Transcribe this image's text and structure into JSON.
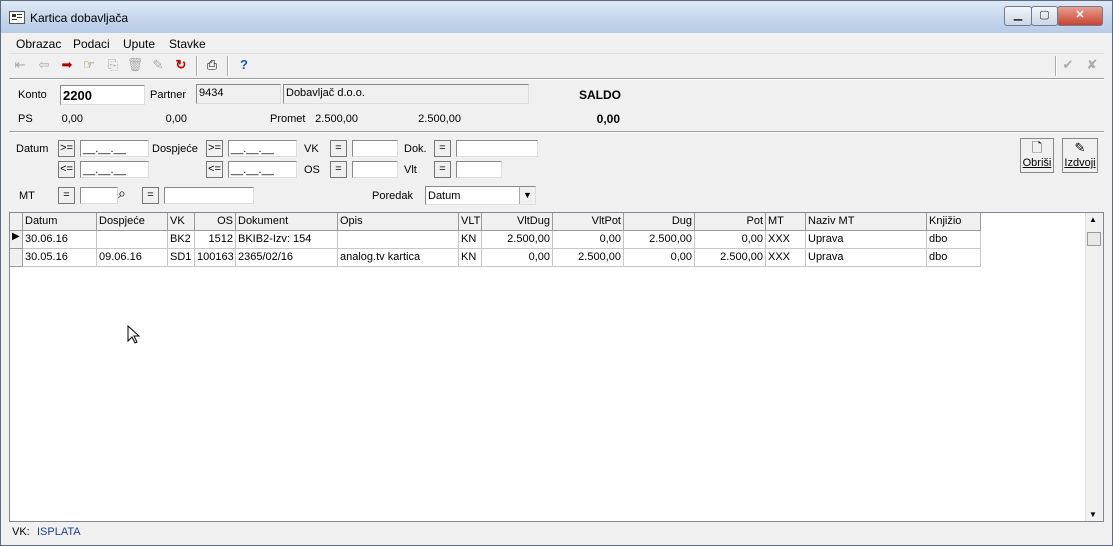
{
  "window": {
    "title": "Kartica dobavljača"
  },
  "window_controls": {
    "minimize": "▁",
    "maximize": "▢",
    "close": "✕"
  },
  "menu": [
    "Obrazac",
    "Podaci",
    "Upute",
    "Stavke"
  ],
  "header": {
    "konto_label": "Konto",
    "konto_value": "2200",
    "partner_label": "Partner",
    "partner_id": "9434",
    "partner_name": "Dobavljač d.o.o.",
    "saldo_label": "SALDO",
    "ps_label": "PS",
    "ps_dug": "0,00",
    "ps_pot": "0,00",
    "promet_label": "Promet",
    "promet_dug": "2.500,00",
    "promet_pot": "2.500,00",
    "saldo_value": "0,00"
  },
  "filters": {
    "datum_label": "Datum",
    "dospijece_label": "Dospjeće",
    "ge": ">=",
    "le": "<=",
    "eq": "=",
    "date_mask": "__.__.__",
    "vk_label": "VK",
    "os_label": "OS",
    "dok_label": "Dok.",
    "vlt_label": "Vlt",
    "mt_label": "MT",
    "poredak_label": "Poredak",
    "poredak_value": "Datum",
    "obrisi_label": "Obriši",
    "izdvoji_label": "Izdvoji"
  },
  "grid": {
    "columns": [
      "Datum",
      "Dospjeće",
      "VK",
      "OS",
      "Dokument",
      "Opis",
      "VLT",
      "VltDug",
      "VltPot",
      "Dug",
      "Pot",
      "MT",
      "Naziv MT",
      "Knjižio"
    ],
    "rows": [
      [
        "30.06.16",
        "",
        "BK2",
        "1512",
        "BKIB2-Izv: 154",
        "",
        "KN",
        "2.500,00",
        "0,00",
        "2.500,00",
        "0,00",
        "XXX",
        "Uprava",
        "dbo"
      ],
      [
        "30.05.16",
        "09.06.16",
        "SD1",
        "100163",
        "2365/02/16",
        "analog.tv kartica",
        "KN",
        "0,00",
        "2.500,00",
        "0,00",
        "2.500,00",
        "XXX",
        "Uprava",
        "dbo"
      ]
    ]
  },
  "status": {
    "label": "VK:",
    "value": "ISPLATA",
    "value_color": "#1a3fa0"
  },
  "colors": {
    "arrow_red": "#b00000",
    "help_blue": "#0a5bc4"
  }
}
